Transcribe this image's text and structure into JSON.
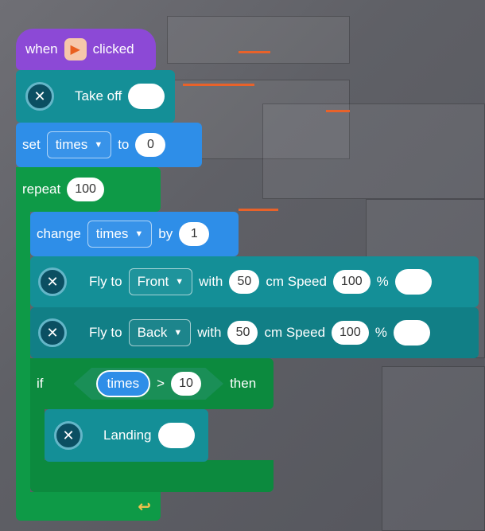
{
  "when_block": {
    "prefix": "when",
    "suffix": "clicked",
    "icon": "play-flag-icon"
  },
  "takeoff_block": {
    "label": "Take off"
  },
  "set_block": {
    "label": "set",
    "var": "times",
    "to_label": "to",
    "value": "0"
  },
  "repeat_block": {
    "label": "repeat",
    "count": "100"
  },
  "change_block": {
    "label": "change",
    "var": "times",
    "by_label": "by",
    "value": "1"
  },
  "fly_front": {
    "label": "Fly to",
    "direction": "Front",
    "with_label": "with",
    "distance": "50",
    "unit_label": "cm Speed",
    "speed": "100",
    "percent": "%"
  },
  "fly_back": {
    "label": "Fly to",
    "direction": "Back",
    "with_label": "with",
    "distance": "50",
    "unit_label": "cm Speed",
    "speed": "100",
    "percent": "%"
  },
  "if_block": {
    "label": "if",
    "var": "times",
    "op": ">",
    "value": "10",
    "then_label": "then"
  },
  "landing_block": {
    "label": "Landing"
  },
  "colors": {
    "event": "#8c49d6",
    "drone": "#148f97",
    "variable": "#2e8ee8",
    "control": "#0e9a47",
    "operator": "#1a8f57"
  }
}
